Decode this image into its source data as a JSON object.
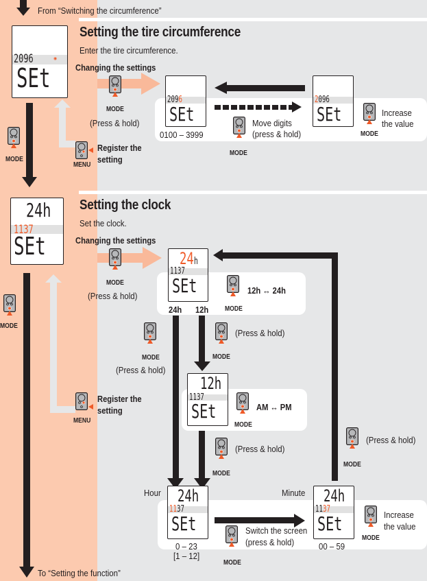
{
  "colors": {
    "peach": "#fccaaf",
    "gray_bg": "#e6e7e8",
    "accent": "#ef5a28",
    "dark": "#231f20",
    "light_arrow": "#f9b99a"
  },
  "top_note": "From “Switching the circumference”",
  "bottom_note": "To “Setting the function”",
  "left_column": {
    "mode_label_1": "MODE",
    "mode_label_2": "MODE",
    "lcd_1": {
      "value": "2096",
      "line2": "SEt"
    },
    "lcd_2": {
      "top": "24h",
      "value": "1137",
      "line2": "SEt"
    }
  },
  "tire": {
    "title": "Setting the tire circumference",
    "subtitle": "Enter the tire circumference.",
    "changing": "Changing the settings",
    "enter_mode": "MODE",
    "enter_hold": "(Press & hold)",
    "register_line1": "Register the",
    "register_line2": "setting",
    "register_btn": "MENU",
    "lcd_a": {
      "digits": "209",
      "active": "6",
      "line2": "SEt"
    },
    "lcd_b": {
      "active": "2",
      "digits": "096",
      "line2": "SEt"
    },
    "range": "0100 – 3999",
    "move_line1": "Move digits",
    "move_line2": "(press & hold)",
    "move_mode": "MODE",
    "inc_line1": "Increase",
    "inc_line2": "the value",
    "inc_mode": "MODE"
  },
  "clock": {
    "title": "Setting the clock",
    "subtitle": "Set the clock.",
    "changing": "Changing the settings",
    "enter_mode": "MODE",
    "enter_hold": "(Press & hold)",
    "register_line1": "Register the",
    "register_line2": "setting",
    "register_btn": "MENU",
    "format_lcd": {
      "top": "24",
      "h": "h",
      "value": "1137",
      "line2": "SEt"
    },
    "label_24h": "24h",
    "label_12h": "12h",
    "toggle_text": "12h ↔ 24h",
    "toggle_mode": "MODE",
    "left_mode": "MODE",
    "left_hold": "(Press & hold)",
    "mid_hold": "(Press & hold)",
    "mid_mode": "MODE",
    "ampm_lcd": {
      "top": "12h",
      "value": "1137",
      "line2": "SEt"
    },
    "ampm_text": "AM ↔ PM",
    "ampm_mode": "MODE",
    "mid2_hold": "(Press & hold)",
    "mid2_mode": "MODE",
    "right_hold": "(Press & hold)",
    "right_mode": "MODE",
    "hour_label": "Hour",
    "hour_lcd": {
      "top": "24h",
      "active": "11",
      "rest": "37",
      "line2": "SEt"
    },
    "hour_range1": "0 – 23",
    "hour_range2": "[1 – 12]",
    "switch_line1": "Switch the screen",
    "switch_line2": "(press & hold)",
    "switch_mode": "MODE",
    "minute_label": "Minute",
    "minute_lcd": {
      "top": "24h",
      "rest": "11",
      "active": "37",
      "line2": "SEt"
    },
    "minute_range": "00 – 59",
    "inc_line1": "Increase",
    "inc_line2": "the value",
    "inc_mode": "MODE"
  }
}
